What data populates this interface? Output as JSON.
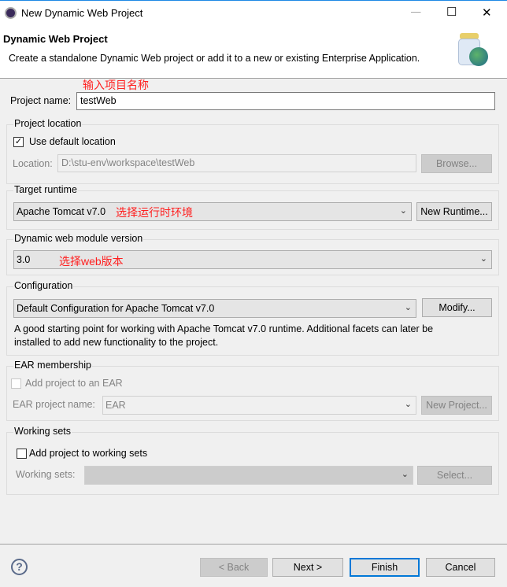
{
  "window": {
    "title": "New Dynamic Web Project",
    "minimize": "—",
    "maximize": "☐",
    "close": "✕"
  },
  "header": {
    "title": "Dynamic Web Project",
    "description": "Create a standalone Dynamic Web project or add it to a new or existing Enterprise Application."
  },
  "annotations": {
    "project_name": "输入项目名称",
    "runtime": "选择运行时环境",
    "web_version": "选择web版本"
  },
  "project_name": {
    "label": "Project name:",
    "value": "testWeb"
  },
  "project_location": {
    "title": "Project location",
    "use_default_label": "Use default location",
    "use_default_checked": true,
    "location_label": "Location:",
    "location_value": "D:\\stu-env\\workspace\\testWeb",
    "browse": "Browse..."
  },
  "target_runtime": {
    "title": "Target runtime",
    "selected": "Apache Tomcat v7.0",
    "new_runtime": "New Runtime..."
  },
  "module_version": {
    "title": "Dynamic web module version",
    "selected": "3.0"
  },
  "configuration": {
    "title": "Configuration",
    "selected": "Default Configuration for Apache Tomcat v7.0",
    "modify": "Modify...",
    "description_line1": "A good starting point for working with Apache Tomcat v7.0 runtime. Additional facets can later be",
    "description_line2": "installed to add new functionality to the project."
  },
  "ear": {
    "title": "EAR membership",
    "add_label": "Add project to an EAR",
    "add_checked": false,
    "name_label": "EAR project name:",
    "name_value": "EAR",
    "new_project": "New Project..."
  },
  "working_sets": {
    "title": "Working sets",
    "add_label": "Add project to working sets",
    "add_checked": false,
    "sets_label": "Working sets:",
    "sets_value": "",
    "select": "Select..."
  },
  "footer": {
    "back": "< Back",
    "next": "Next >",
    "finish": "Finish",
    "cancel": "Cancel",
    "help": "?"
  }
}
